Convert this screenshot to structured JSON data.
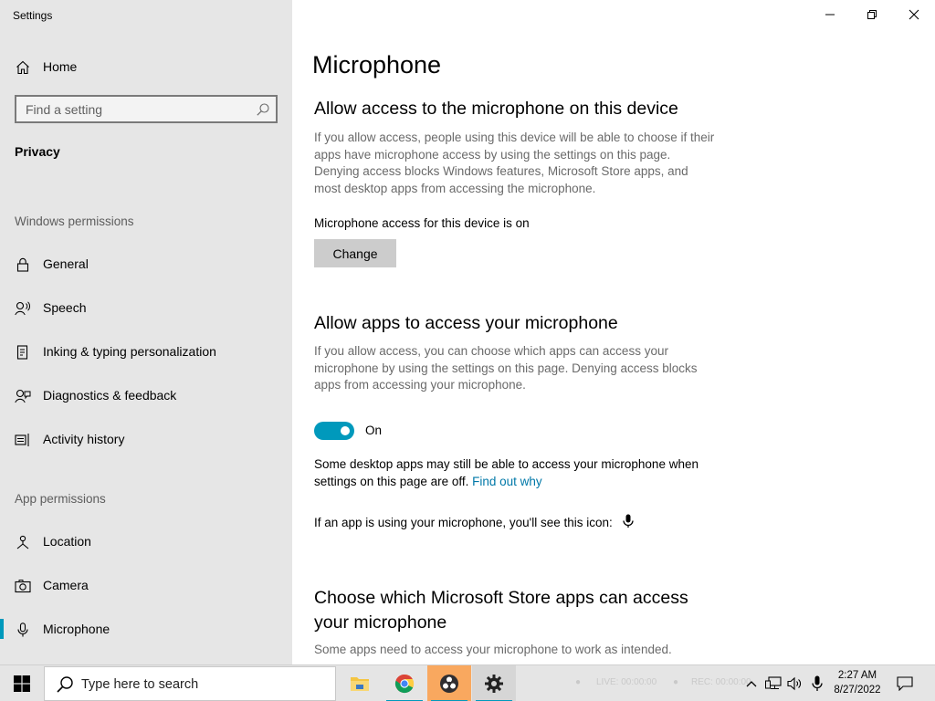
{
  "window": {
    "app_title": "Settings"
  },
  "sidebar": {
    "home_label": "Home",
    "search_placeholder": "Find a setting",
    "privacy_label": "Privacy",
    "windows_permissions_heading": "Windows permissions",
    "windows_permissions": [
      {
        "label": "General",
        "icon": "lock-icon"
      },
      {
        "label": "Speech",
        "icon": "speech-icon"
      },
      {
        "label": "Inking & typing personalization",
        "icon": "inking-icon"
      },
      {
        "label": "Diagnostics & feedback",
        "icon": "diagnostics-icon"
      },
      {
        "label": "Activity history",
        "icon": "activity-history-icon"
      }
    ],
    "app_permissions_heading": "App permissions",
    "app_permissions": [
      {
        "label": "Location",
        "icon": "location-icon"
      },
      {
        "label": "Camera",
        "icon": "camera-icon"
      },
      {
        "label": "Microphone",
        "icon": "microphone-icon",
        "selected": true
      }
    ]
  },
  "main": {
    "page_title": "Microphone",
    "device_section": {
      "heading": "Allow access to the microphone on this device",
      "description": "If you allow access, people using this device will be able to choose if their apps have microphone access by using the settings on this page. Denying access blocks Windows features, Microsoft Store apps, and most desktop apps from accessing the microphone.",
      "status": "Microphone access for this device is on",
      "change_button": "Change"
    },
    "apps_section": {
      "heading": "Allow apps to access your microphone",
      "description": "If you allow access, you can choose which apps can access your microphone by using the settings on this page. Denying access blocks apps from accessing your microphone.",
      "toggle_state": "On",
      "note": "Some desktop apps may still be able to access your microphone when settings on this page are off.",
      "note_link": "Find out why",
      "icon_note": "If an app is using your microphone, you'll see this icon:"
    },
    "store_section": {
      "heading": "Choose which Microsoft Store apps can access your microphone",
      "description": "Some apps need to access your microphone to work as intended."
    }
  },
  "taskbar": {
    "search_placeholder": "Type here to search",
    "apps": [
      "file-explorer-icon",
      "chrome-icon",
      "obs-icon",
      "settings-gear-icon"
    ],
    "live_text": "LIVE: 00:00:00",
    "rec_text": "REC: 00:00:00",
    "time": "2:27 AM",
    "date": "8/27/2022"
  },
  "colors": {
    "accent": "#0099bc",
    "link": "#0078a8",
    "sidebar_bg": "#e6e6e6"
  }
}
